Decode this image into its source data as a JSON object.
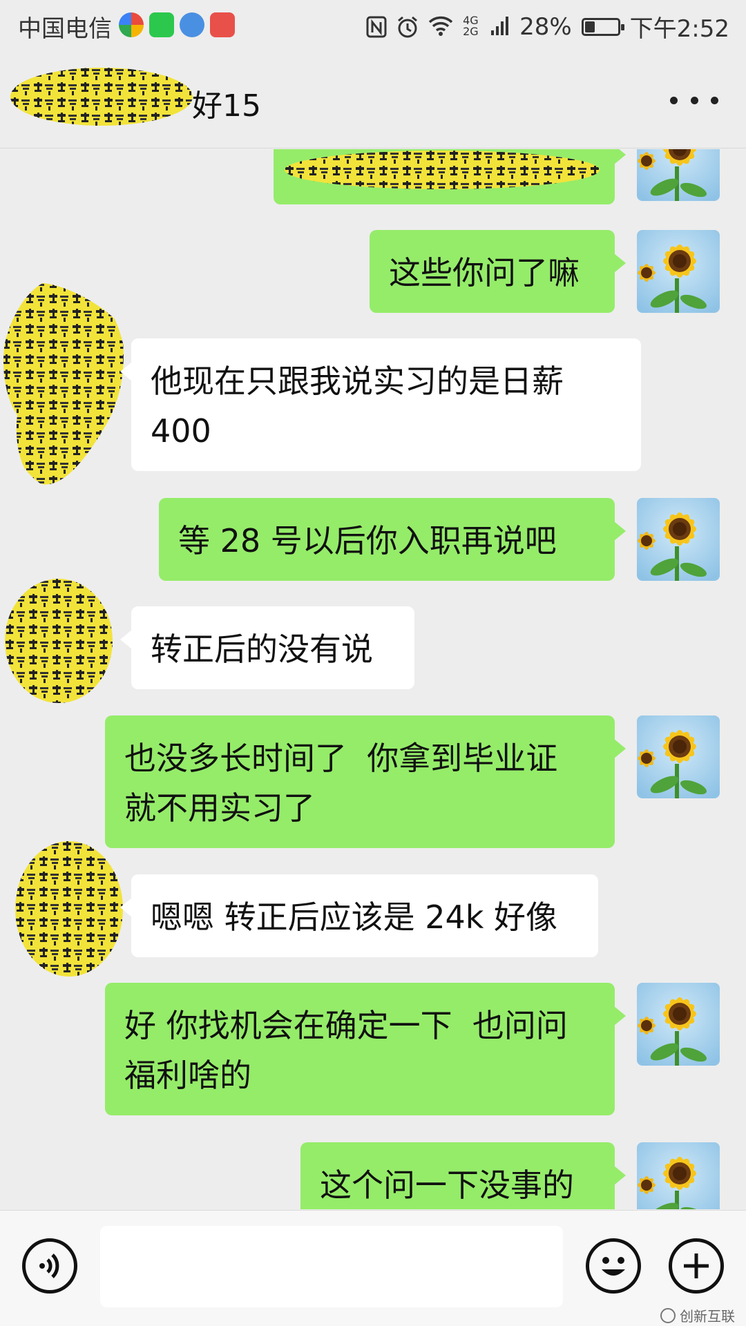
{
  "status_bar": {
    "carrier": "中国电信",
    "network": "4G 2G",
    "battery": "28%",
    "battery_level": 0.28,
    "time": "下午2:52",
    "icons": [
      "nfc-icon",
      "alarm-icon",
      "wifi-icon",
      "signal-icon",
      "battery-icon"
    ]
  },
  "header": {
    "title": "好15",
    "more_icon": "more-dots-icon"
  },
  "messages": [
    {
      "side": "out",
      "text": ""
    },
    {
      "side": "out",
      "text": "这些你问了嘛"
    },
    {
      "side": "in",
      "text": "他现在只跟我说实习的是日薪\n400"
    },
    {
      "side": "out",
      "text": "等 28 号以后你入职再说吧"
    },
    {
      "side": "in",
      "text": "转正后的没有说"
    },
    {
      "side": "out",
      "text": "也没多长时间了  你拿到毕业证\n就不用实习了"
    },
    {
      "side": "in",
      "text": "嗯嗯 转正后应该是 24k 好像"
    },
    {
      "side": "out",
      "text": "好 你找机会在确定一下  也问问\n福利啥的"
    },
    {
      "side": "out",
      "text": "这个问一下没事的"
    }
  ],
  "input_bar": {
    "voice_icon": "voice-icon",
    "emoji_icon": "emoji-icon",
    "plus_icon": "plus-icon",
    "input_value": ""
  },
  "colors": {
    "background": "#ededed",
    "outgoing_bubble": "#95ec69",
    "incoming_bubble": "#ffffff",
    "mosaic_yellow": "#f2e33a"
  },
  "watermark": {
    "text": "创新互联"
  }
}
